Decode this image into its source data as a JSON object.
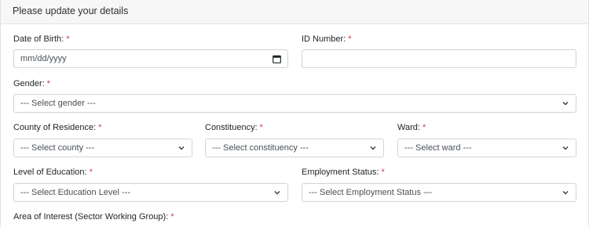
{
  "header": {
    "title": "Please update your details"
  },
  "form": {
    "dob": {
      "label": "Date of Birth:",
      "value": "mm/dd/yyyy"
    },
    "id_number": {
      "label": "ID Number:",
      "value": ""
    },
    "gender": {
      "label": "Gender:",
      "value": "--- Select gender ---"
    },
    "county": {
      "label": "County of Residence:",
      "value": "--- Select county ---"
    },
    "constituency": {
      "label": "Constituency:",
      "value": "--- Select constituency ---"
    },
    "ward": {
      "label": "Ward:",
      "value": "--- Select ward ---"
    },
    "education": {
      "label": "Level of Education:",
      "value": "--- Select Education Level ---"
    },
    "employment": {
      "label": "Employment Status:",
      "value": "--- Select Employment Status ---"
    },
    "interest": {
      "label": "Area of Interest (Sector Working Group):"
    },
    "required_mark": "*"
  },
  "icons": {
    "dropdown": "chevron-down-icon",
    "date": "calendar-icon"
  },
  "colors": {
    "required": "#dc3545",
    "border": "#ced4da",
    "header_bg": "#f7f7f7"
  }
}
